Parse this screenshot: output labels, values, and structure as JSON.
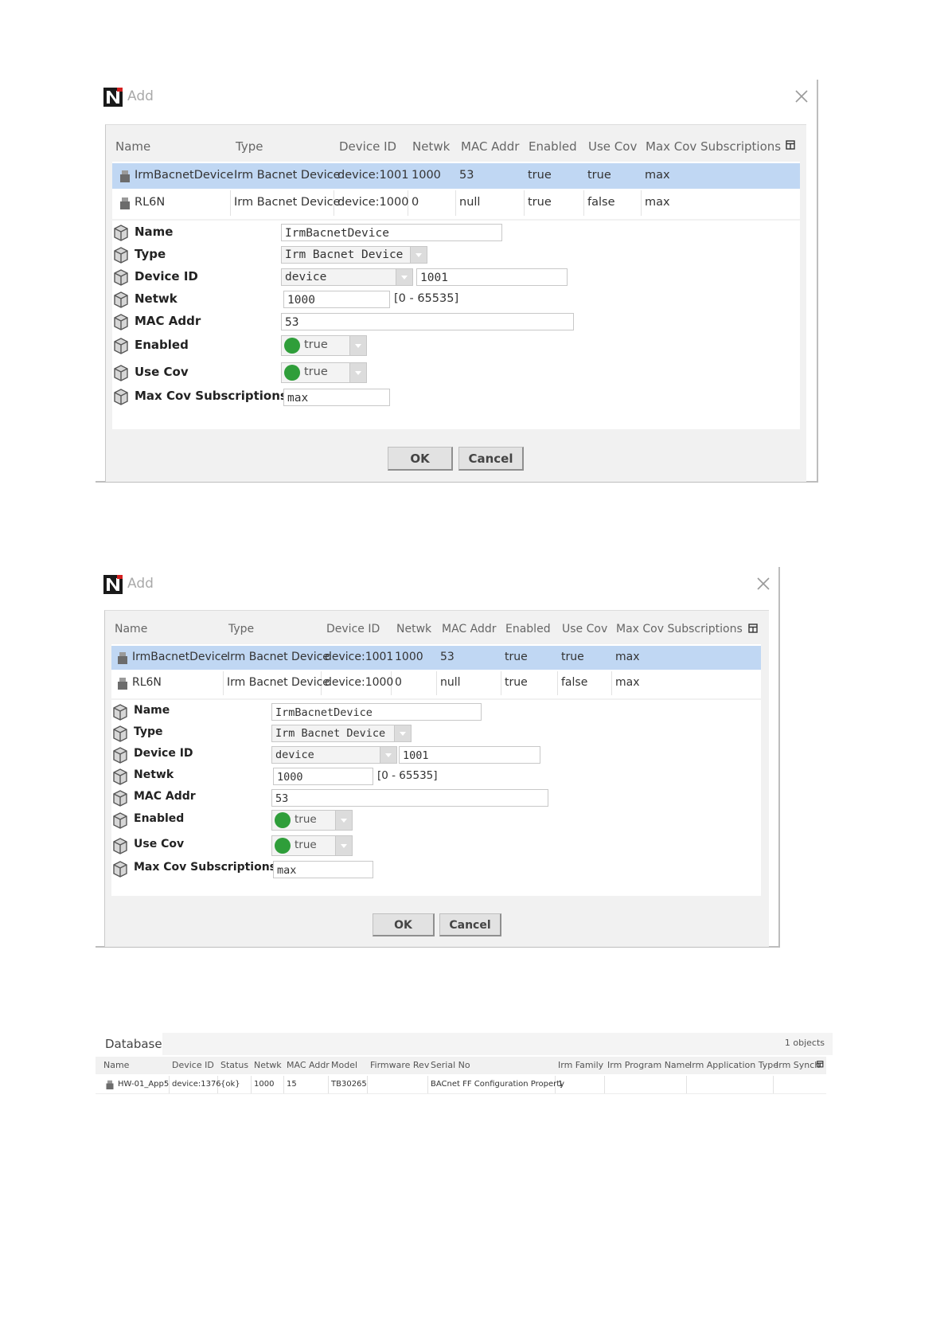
{
  "dialog": {
    "title": "Add",
    "columns": [
      "Name",
      "Type",
      "Device ID",
      "Netwk",
      "MAC Addr",
      "Enabled",
      "Use Cov",
      "Max Cov Subscriptions"
    ],
    "rows": [
      [
        "IrmBacnetDevice",
        "Irm Bacnet Device",
        "device:1001",
        "1000",
        "53",
        "true",
        "true",
        "max"
      ],
      [
        "RL6N",
        "Irm Bacnet Device",
        "device:1000",
        "0",
        "null",
        "true",
        "false",
        "max"
      ]
    ],
    "selected_row": 0,
    "labels": {
      "name": "Name",
      "type": "Type",
      "device_id": "Device ID",
      "netwk": "Netwk",
      "mac_addr": "MAC Addr",
      "enabled": "Enabled",
      "use_cov": "Use Cov",
      "max_cov": "Max Cov Subscriptions"
    },
    "values": {
      "name": "IrmBacnetDevice",
      "type": "Irm Bacnet Device",
      "device_id_type": "device",
      "device_id_num": "1001",
      "netwk": "1000",
      "netwk_range": "[0 - 65535]",
      "mac_addr": "53",
      "enabled": "true",
      "use_cov": "true",
      "max_cov": "max"
    },
    "ok_label": "OK",
    "cancel_label": "Cancel"
  },
  "database": {
    "tab_label": "Database",
    "count": "1 objects",
    "columns": [
      "Name",
      "Device ID",
      "Status",
      "Netwk",
      "MAC Addr",
      "Model",
      "Firmware Rev",
      "Serial No",
      "Irm Family",
      "Irm Program Name",
      "Irm Application Type",
      "Irm Synch"
    ],
    "row": [
      "HW-01_App5",
      "device:1376",
      "{ok}",
      "1000",
      "15",
      "TB30265",
      "",
      "BACnet FF Configuration Property",
      "1",
      "",
      "",
      ""
    ]
  },
  "colors": {
    "selected_row": "#c0d7f3",
    "enabled_dot": "#2f9e3a",
    "logo": "#1a1a1a",
    "logo_accent": "#d42020"
  }
}
